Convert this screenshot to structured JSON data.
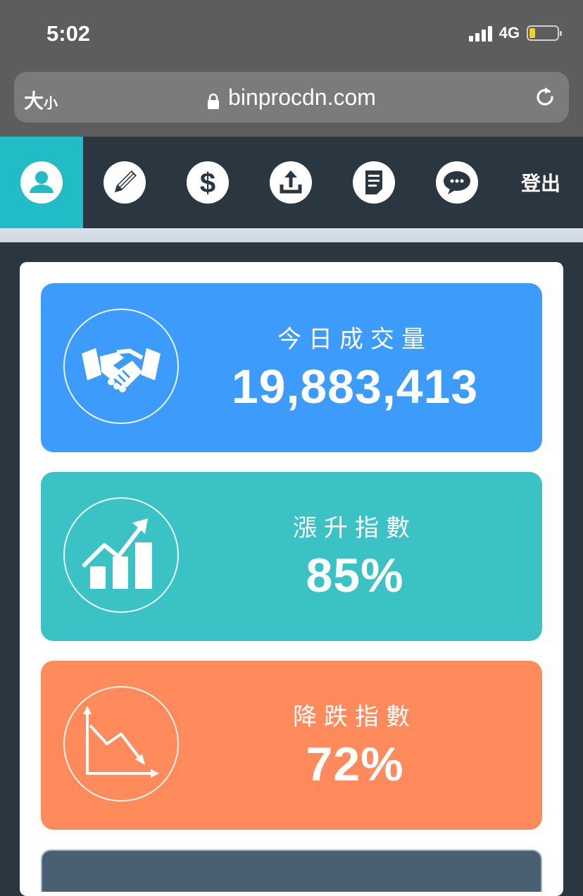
{
  "status_bar": {
    "time": "5:02",
    "network": "4G",
    "battery_level": 0.2,
    "battery_color": "#f4d123"
  },
  "browser": {
    "text_size_big": "大",
    "text_size_small": "小",
    "domain": "binprocdn.com",
    "icons": [
      "lock-icon",
      "reload-icon"
    ]
  },
  "nav": {
    "active_color": "#21bcc6",
    "items": [
      {
        "icon": "user-icon",
        "active": true
      },
      {
        "icon": "pencil-icon",
        "active": false
      },
      {
        "icon": "dollar-icon",
        "active": false
      },
      {
        "icon": "upload-icon",
        "active": false
      },
      {
        "icon": "document-icon",
        "active": false
      },
      {
        "icon": "chat-icon",
        "active": false
      }
    ],
    "logout_label": "登出"
  },
  "stats": [
    {
      "label": "今日成交量",
      "value": "19,883,413",
      "color": "#3d9cfb",
      "icon": "handshake-icon"
    },
    {
      "label": "漲升指數",
      "value": "85%",
      "color": "#3bc2c4",
      "icon": "chart-up-icon"
    },
    {
      "label": "降跌指數",
      "value": "72%",
      "color": "#ff8a5c",
      "icon": "chart-down-icon"
    }
  ]
}
